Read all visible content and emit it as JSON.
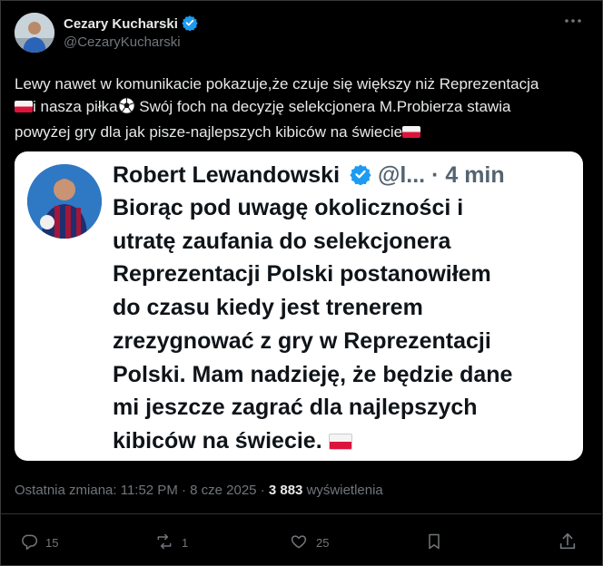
{
  "author": {
    "name": "Cezary Kucharski",
    "handle": "@CezaryKucharski"
  },
  "tweet": {
    "line1": "Lewy nawet w komunikacie pokazuje,że czuje się większy niż Reprezentacja",
    "line2a": "i nasza piłka",
    "line2b": " Swój foch na decyzję selekcjonera M.Probierza stawia",
    "line3": "powyżej gry dla jak pisze-najlepszych kibiców na świecie"
  },
  "quoted": {
    "name": "Robert Lewandowski",
    "handle": "@l...",
    "time": "· 4 min",
    "lines": [
      "Biorąc pod uwagę okoliczności i",
      "utratę zaufania do selekcjonera",
      "Reprezentacji Polski postanowiłem",
      "do czasu kiedy jest trenerem",
      "zrezygnować z gry w Reprezentacji",
      "Polski. Mam nadzieję, że będzie dane",
      "mi jeszcze zagrać dla najlepszych",
      "kibiców na świecie."
    ]
  },
  "meta": {
    "prefix": "Ostatnia zmiana: 11:52 PM · 8 cze 2025 · ",
    "views": "3 883",
    "views_label": " wyświetlenia"
  },
  "actions": {
    "replies": "15",
    "reposts": "1",
    "likes": "25"
  },
  "colors": {
    "background": "#000000",
    "text": "#e7e9ea",
    "muted": "#71767b",
    "verified": "#1d9bf0",
    "card": "#ffffff"
  },
  "icons": [
    "more-icon",
    "verified-badge-icon",
    "poland-flag-icon",
    "soccer-ball-icon",
    "reply-icon",
    "repost-icon",
    "like-icon",
    "bookmark-icon",
    "share-icon"
  ]
}
